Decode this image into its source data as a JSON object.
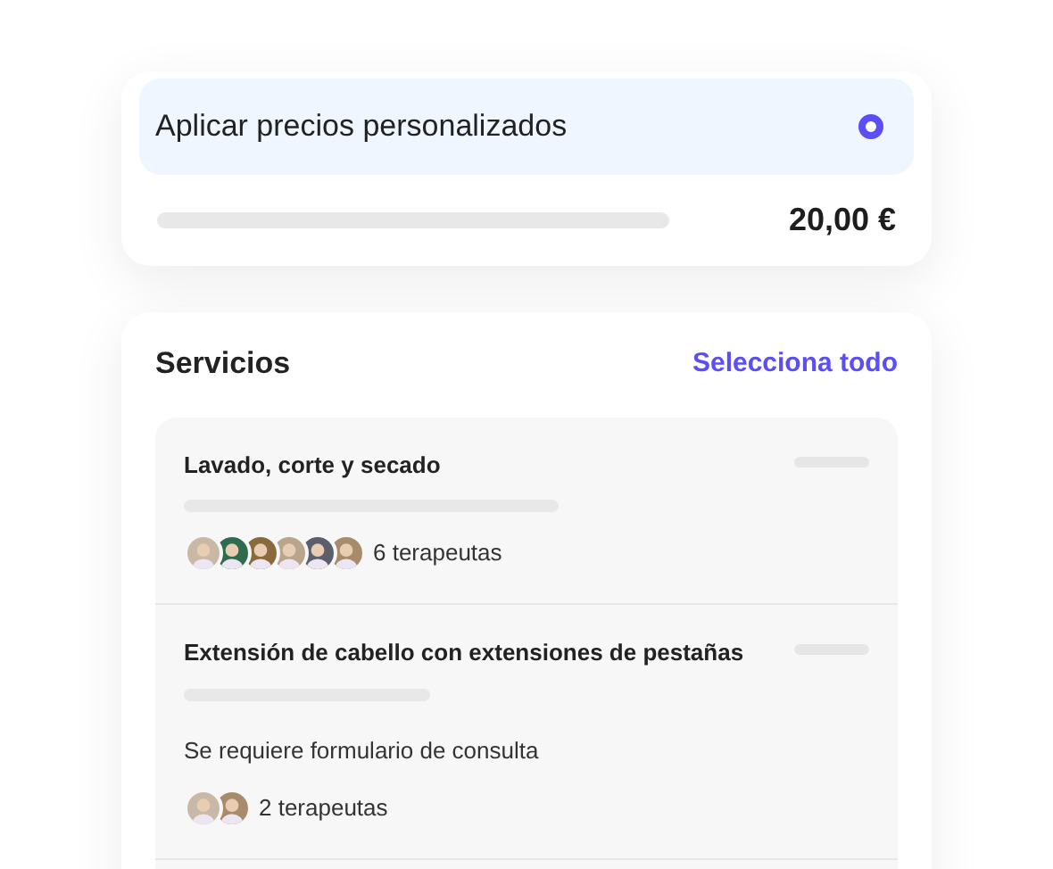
{
  "pricing": {
    "option": {
      "label": "Aplicar precios personalizados",
      "selected": true
    },
    "price": "20,00 €"
  },
  "services": {
    "title": "Servicios",
    "select_all": "Selecciona todo",
    "items": [
      {
        "kind": "service",
        "name": "Lavado, corte y secado",
        "therapists": "6 terapeutas"
      },
      {
        "kind": "service",
        "name": "Extensión de cabello con extensiones de pestañas",
        "note": "Se requiere formulario de consulta",
        "therapists": "2 terapeutas"
      },
      {
        "kind": "cut_off"
      }
    ]
  }
}
